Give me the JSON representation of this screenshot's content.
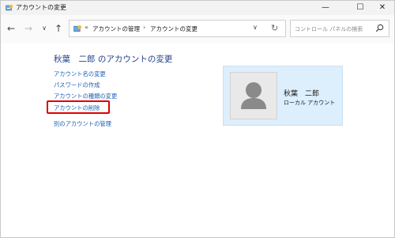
{
  "window": {
    "title": "アカウントの変更",
    "controls": {
      "minimize": "—",
      "maximize": "☐",
      "close": "✕"
    }
  },
  "nav": {
    "back": "←",
    "forward": "→",
    "recent": "∨",
    "up": "↑"
  },
  "address": {
    "more": "«",
    "segments": [
      "アカウントの管理",
      "アカウントの変更"
    ],
    "separator": "›",
    "dropdown": "∨",
    "refresh": "↻"
  },
  "search": {
    "placeholder": "コントロール パネルの検索"
  },
  "page": {
    "title": "秋葉　二郎 のアカウントの変更",
    "links": [
      "アカウント名の変更",
      "パスワードの作成",
      "アカウントの種類の変更",
      "アカウントの削除",
      "別のアカウントの管理"
    ],
    "highlighted_link_index": 3
  },
  "user": {
    "name": "秋葉　二郎",
    "type": "ローカル アカウント"
  },
  "colors": {
    "link": "#1a5fb4",
    "title": "#1e3f8a",
    "highlight": "#e00000",
    "card": "#ddeefc"
  },
  "icons": [
    "control-panel-icon",
    "user-avatar-icon",
    "search-icon"
  ]
}
